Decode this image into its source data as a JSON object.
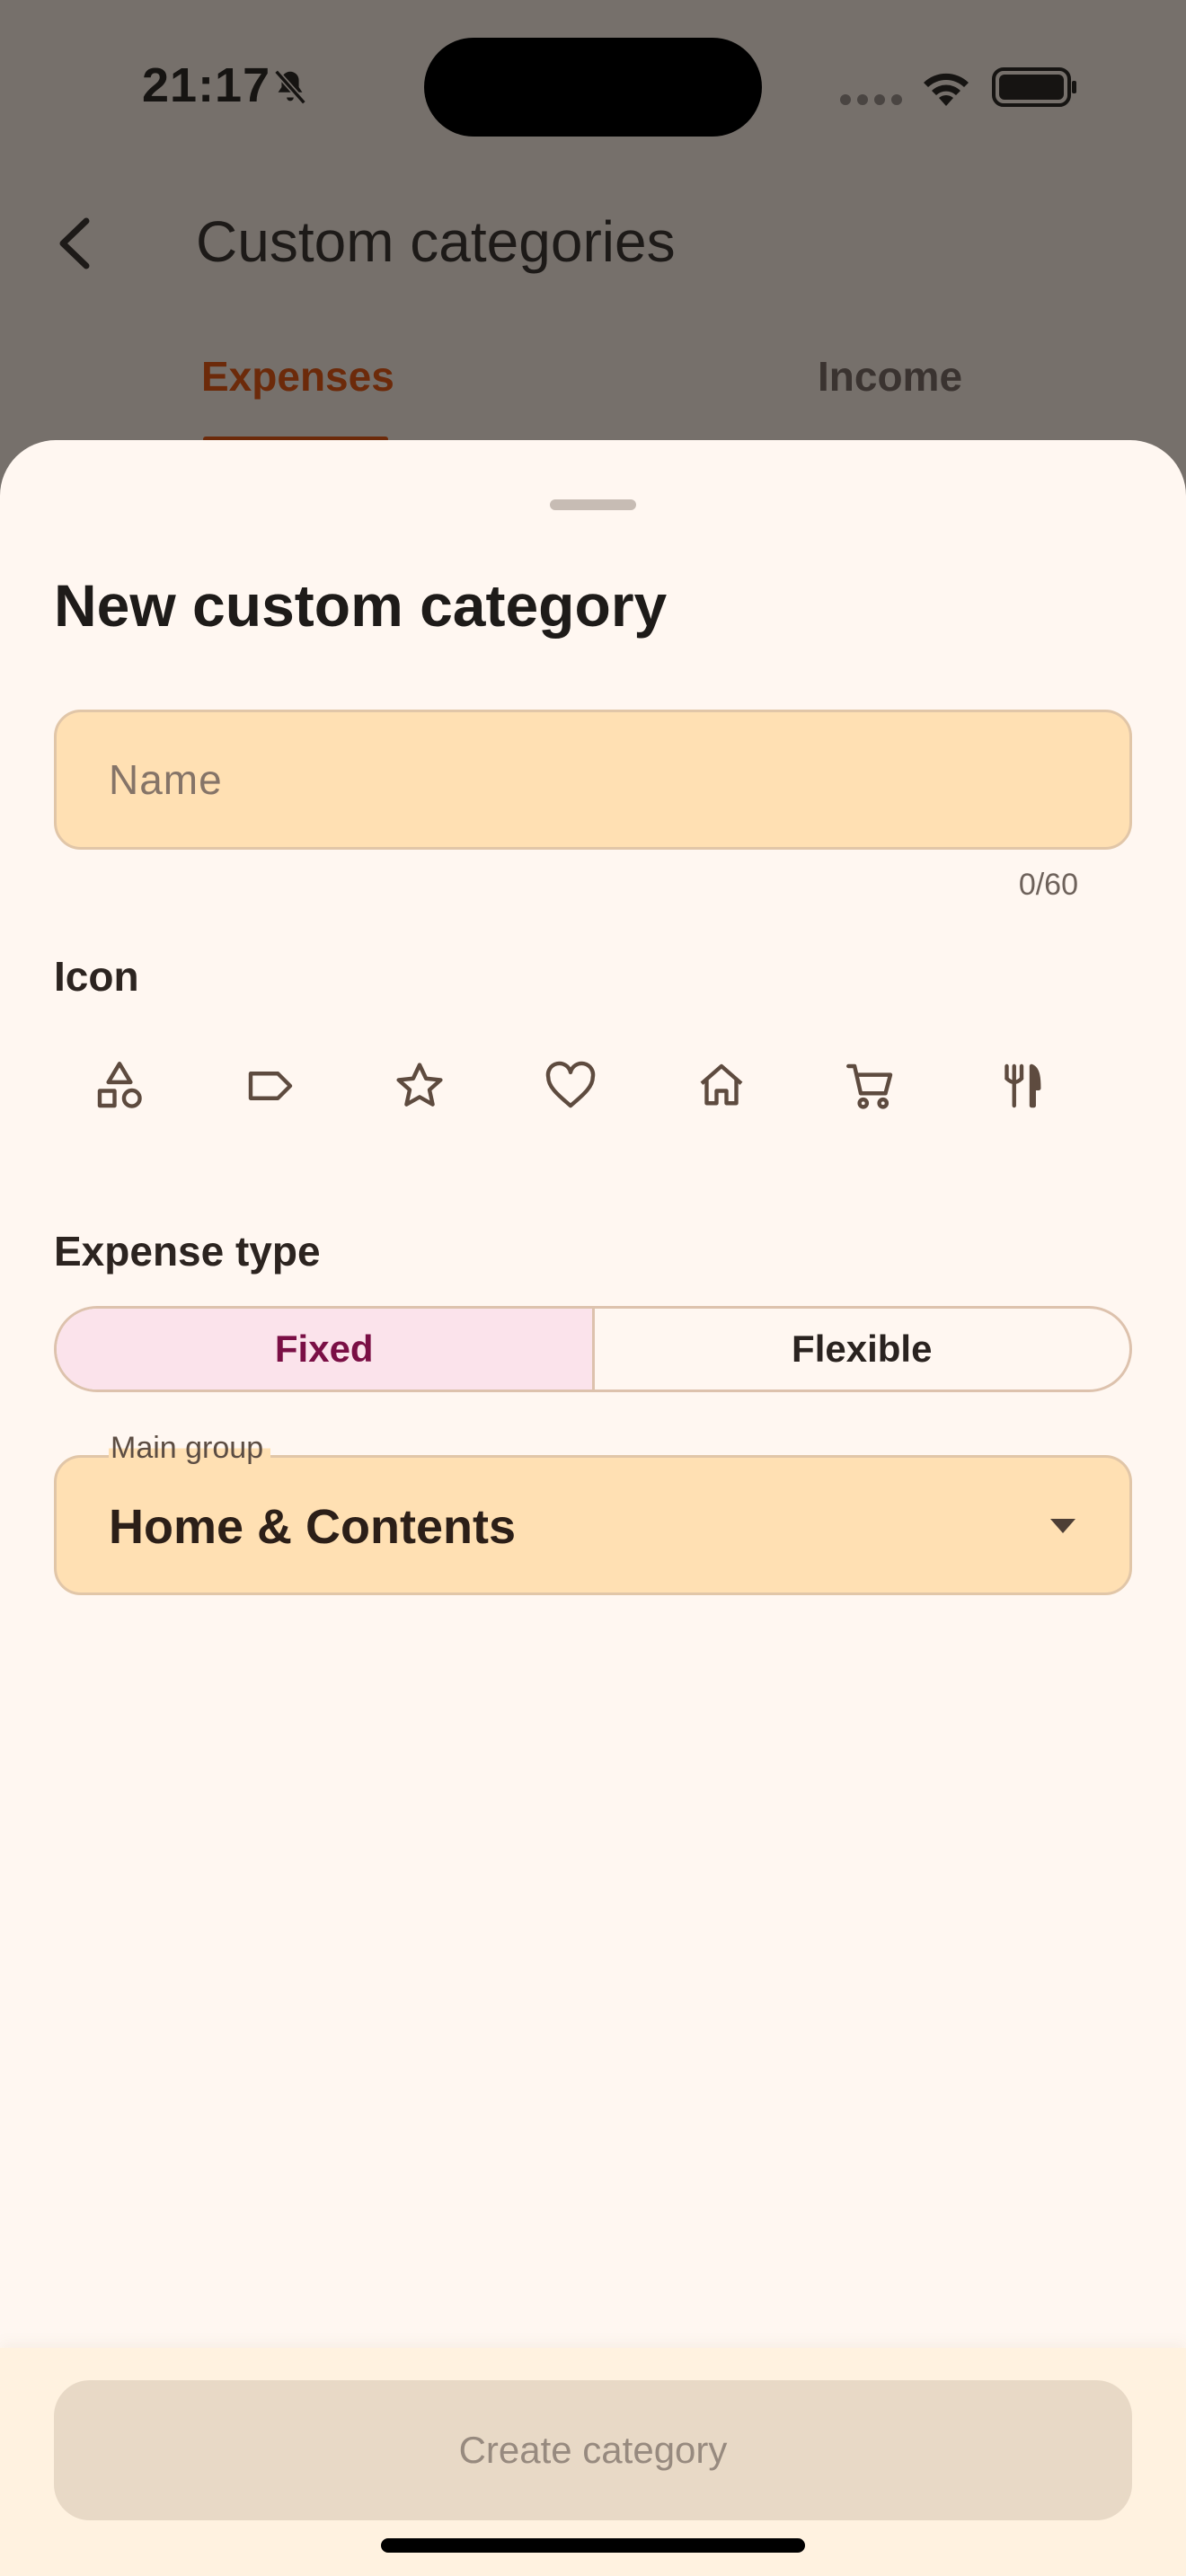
{
  "status_bar": {
    "time": "21:17",
    "icons": [
      "bell-slash-icon",
      "signal-dots-icon",
      "wifi-icon",
      "battery-icon"
    ]
  },
  "app_bar": {
    "title": "Custom categories",
    "back_icon": "chevron-left-icon"
  },
  "tabs": [
    {
      "label": "Expenses",
      "selected": true
    },
    {
      "label": "Income",
      "selected": false
    }
  ],
  "sheet": {
    "title": "New custom category",
    "name_field": {
      "placeholder": "Name",
      "value": "",
      "counter": "0/60"
    },
    "icon_section": {
      "label": "Icon",
      "icons": [
        "shapes-icon",
        "label-icon",
        "star-icon",
        "heart-icon",
        "home-icon",
        "shopping-cart-icon",
        "restaurant-icon"
      ]
    },
    "expense_type": {
      "label": "Expense type",
      "options": [
        "Fixed",
        "Flexible"
      ],
      "selected": "Fixed"
    },
    "main_group": {
      "label": "Main group",
      "value": "Home & Contents"
    },
    "create_button": "Create category"
  },
  "colors": {
    "sheet_background": "#fff7f1",
    "field_background": "#ffe0b3",
    "accent_tab": "#6c2a0a",
    "selected_segment": "#fbe3eb",
    "selected_segment_text": "#7a0f45",
    "disabled_button": "#e8d9c6"
  }
}
